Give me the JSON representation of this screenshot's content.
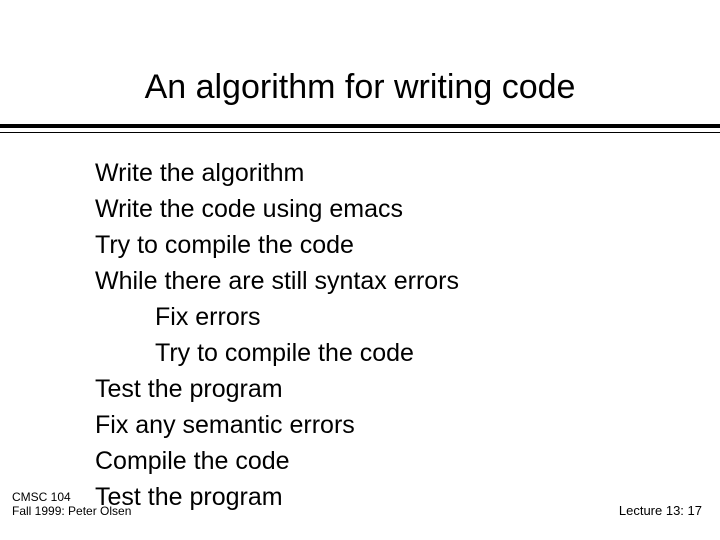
{
  "title": "An algorithm for writing code",
  "lines": {
    "l1": "Write the algorithm",
    "l2": "Write the code using emacs",
    "l3": "Try to compile the code",
    "l4": "While there are still syntax errors",
    "l5": "Fix errors",
    "l6": "Try to compile the code",
    "l7": "Test the program",
    "l8": "Fix any semantic errors",
    "l9": "Compile the code",
    "l10": "Test the program"
  },
  "footer": {
    "left_line1": "CMSC 104",
    "left_line2": "Fall 1999: Peter Olsen",
    "right": "Lecture 13: 17"
  }
}
